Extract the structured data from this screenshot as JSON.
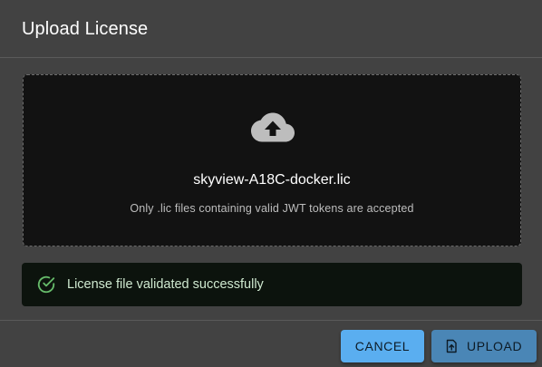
{
  "dialog": {
    "title": "Upload License"
  },
  "dropzone": {
    "icon": "cloud-upload-icon",
    "file_name": "skyview-A18C-docker.lic",
    "helper_text": "Only .lic files containing valid JWT tokens are accepted"
  },
  "alert": {
    "icon": "check-circle-icon",
    "message": "License file validated successfully",
    "color": "#66bb6a"
  },
  "actions": {
    "cancel_label": "CANCEL",
    "upload_label": "UPLOAD",
    "upload_icon": "file-upload-icon"
  },
  "colors": {
    "dialog_bg": "#424242",
    "dropzone_bg": "#121212",
    "button_primary": "#5aaef0",
    "success_bg": "#0c130d"
  }
}
